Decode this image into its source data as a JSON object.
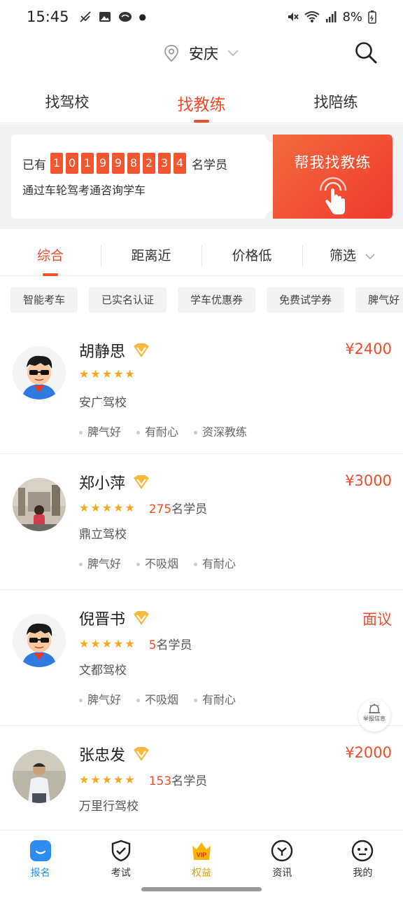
{
  "status_bar": {
    "time": "15:45",
    "battery": "8%"
  },
  "location": {
    "city": "安庆"
  },
  "top_tabs": [
    "找驾校",
    "找教练",
    "找陪练"
  ],
  "banner": {
    "prefix": "已有",
    "digits": [
      "1",
      "0",
      "1",
      "9",
      "9",
      "8",
      "2",
      "3",
      "4"
    ],
    "suffix": "名学员",
    "subtitle": "通过车轮驾考通咨询学车",
    "cta": "帮我找教练"
  },
  "sort_tabs": [
    "综合",
    "距离近",
    "价格低",
    "筛选"
  ],
  "filter_chips": [
    "智能考车",
    "已实名认证",
    "学车优惠券",
    "免费试学券",
    "脾气好"
  ],
  "coaches": [
    {
      "name": "胡静思",
      "price": "¥2400",
      "students_count": "",
      "students_label": "",
      "school": "安广驾校",
      "tags": [
        "脾气好",
        "有耐心",
        "资深教练"
      ],
      "rating": 5
    },
    {
      "name": "郑小萍",
      "price": "¥3000",
      "students_count": "275",
      "students_label": "名学员",
      "school": "鼎立驾校",
      "tags": [
        "脾气好",
        "不吸烟",
        "有耐心"
      ],
      "rating": 5
    },
    {
      "name": "倪晋书",
      "price": "面议",
      "students_count": "5",
      "students_label": "名学员",
      "school": "文都驾校",
      "tags": [
        "脾气好",
        "不吸烟",
        "有耐心"
      ],
      "rating": 5
    },
    {
      "name": "张忠发",
      "price": "¥2000",
      "students_count": "153",
      "students_label": "名学员",
      "school": "万里行驾校",
      "tags": [],
      "rating": 5
    }
  ],
  "float_button": {
    "label": "举报信息"
  },
  "bottom_nav": [
    {
      "label": "报名",
      "icon": "signup-icon"
    },
    {
      "label": "考试",
      "icon": "exam-shield-icon"
    },
    {
      "label": "权益",
      "icon": "vip-crown-icon",
      "badge": "VIP"
    },
    {
      "label": "资讯",
      "icon": "news-icon"
    },
    {
      "label": "我的",
      "icon": "profile-icon"
    }
  ],
  "colors": {
    "accent": "#f04b2b",
    "star": "#f7a81d",
    "nav_active": "#1e90ff"
  }
}
